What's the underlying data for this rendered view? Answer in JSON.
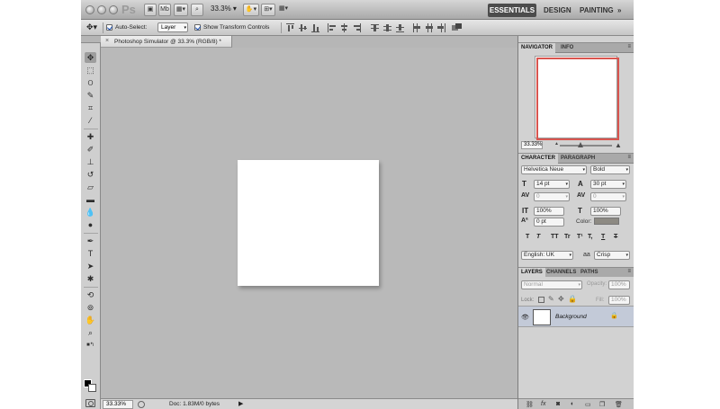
{
  "appbar": {
    "logo": "Ps",
    "mb_label": "Mb",
    "zoom": "33.3%",
    "workspaces": {
      "essentials": "ESSENTIALS",
      "design": "DESIGN",
      "painting": "PAINTING",
      "more": "»"
    }
  },
  "options": {
    "auto_select_label": "Auto-Select:",
    "auto_select_value": "Layer",
    "show_transform_label": "Show Transform Controls"
  },
  "document": {
    "tab_title": "Photoshop Simulator @ 33.3% (RGB/8) *",
    "close_glyph": "×"
  },
  "status": {
    "zoom": "33.33%",
    "doc": "Doc: 1.83M/0 bytes",
    "arrow": "▶"
  },
  "navigator": {
    "tabs": [
      "NAVIGATOR",
      "INFO"
    ],
    "zoom": "33.33%"
  },
  "character": {
    "tabs": [
      "CHARACTER",
      "PARAGRAPH"
    ],
    "font_family": "Helvetica Neue",
    "font_style": "Bold",
    "font_size": "14 pt",
    "leading": "30 pt",
    "kerning": "0",
    "tracking": "0",
    "vertical_scale": "100%",
    "horizontal_scale": "100%",
    "baseline_shift": "0 pt",
    "color_label": "Color:",
    "type_styles": [
      "T",
      "T",
      "TT",
      "Tr",
      "T¹",
      "T,",
      "T",
      "T"
    ],
    "language": "English: UK",
    "aa_label": "aa",
    "antialias": "Crisp",
    "colors": {
      "text_color_swatch": "#8d8a83"
    }
  },
  "layers": {
    "tabs": [
      "LAYERS",
      "CHANNELS",
      "PATHS"
    ],
    "blend_mode": "Normal",
    "opacity_label": "Opacity:",
    "opacity": "100%",
    "lock_label": "Lock:",
    "fill_label": "Fill:",
    "fill": "100%",
    "layer_name": "Background"
  },
  "colors": {
    "accent_active": "#4c4c4c",
    "navigator_frame": "#d9554f",
    "layer_selected": "#c3cad8"
  }
}
